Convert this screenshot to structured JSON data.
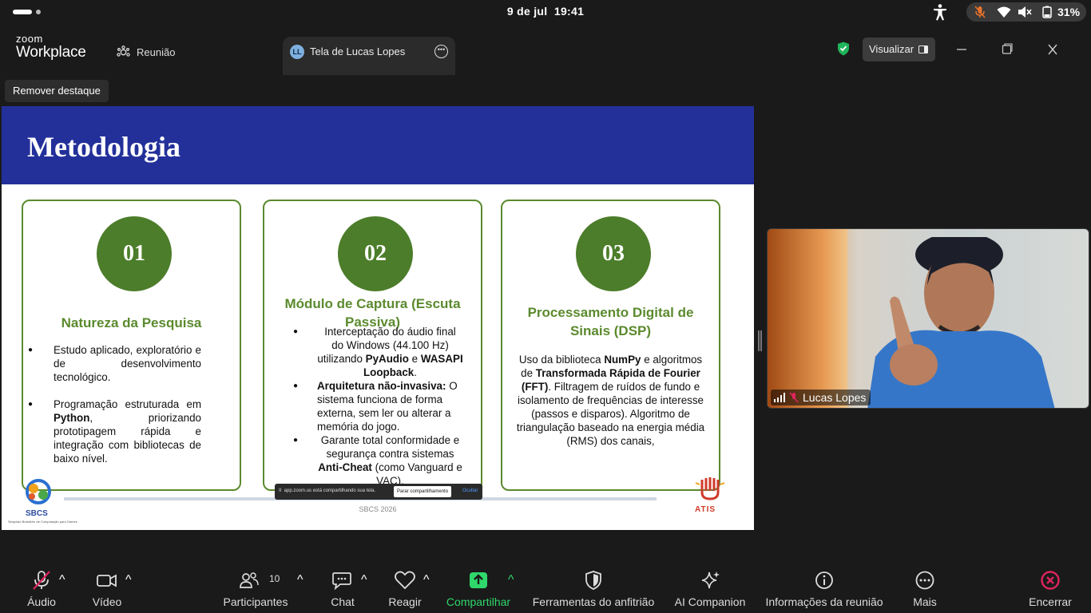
{
  "status_bar": {
    "date": "9 de jul",
    "time": "19:41",
    "battery": "31%"
  },
  "titlebar": {
    "logo_line1": "zoom",
    "logo_line2": "Workplace",
    "tab_meeting": "Reunião",
    "tab_share_avatar": "LL",
    "tab_share_label": "Tela de Lucas Lopes",
    "visualizar": "Visualizar"
  },
  "stage": {
    "remover_destaque": "Remover destaque"
  },
  "slide": {
    "title": "Metodologia",
    "cards": [
      {
        "number": "01",
        "title": "Natureza da Pesquisa",
        "b1": "Estudo aplicado, exploratório e de desenvolvimento tecnológico.",
        "b2_pre": "Programação estruturada em ",
        "b2_bold": "Python",
        "b2_post": ", priorizando prototipagem rápida e integração com bibliotecas de baixo nível."
      },
      {
        "number": "02",
        "title": "Módulo de Captura (Escuta Passiva)",
        "b1_pre": "Interceptação do áudio final do Windows (44.100 Hz) utilizando ",
        "b1_bold1": "PyAudio",
        "b1_mid": " e ",
        "b1_bold2": "WASAPI Loopback",
        "b1_post": ".",
        "b2_bold": "Arquitetura não-invasiva:",
        "b2_post": " O sistema funciona de forma externa, sem ler ou alterar a memória do jogo.",
        "b3_pre": "Garante total conformidade e segurança contra sistemas ",
        "b3_bold": "Anti-Cheat",
        "b3_post": " (como Vanguard e VAC)."
      },
      {
        "number": "03",
        "title": "Processamento Digital de Sinais (DSP)",
        "p_pre": "Uso da biblioteca ",
        "p_bold1": "NumPy",
        "p_mid": " e algoritmos de ",
        "p_bold2": "Transformada Rápida de Fourier (FFT)",
        "p_post": ". Filtragem de ruídos de fundo e isolamento de frequências de interesse (passos e disparos). Algoritmo de triangulação baseado na energia média (RMS) dos canais,"
      }
    ],
    "logo_left": "SBCS",
    "logo_left_small": "Simpósio Brasileiro de Computação para Games",
    "footer": "SBCS 2026",
    "logo_right": "ATIS"
  },
  "share_notice": {
    "text": "app.zoom.us está compartilhando sua tela.",
    "stop": "Parar compartilhamento",
    "hide": "Ocultar"
  },
  "video": {
    "name": "Lucas Lopes"
  },
  "toolbar": {
    "audio": "Áudio",
    "video": "Vídeo",
    "participants": "Participantes",
    "participants_count": "10",
    "chat": "Chat",
    "react": "Reagir",
    "share": "Compartilhar",
    "host_tools": "Ferramentas do anfitrião",
    "ai": "AI Companion",
    "info": "Informações da reunião",
    "more": "Mais",
    "end": "Encerrar"
  },
  "colors": {
    "slide_header": "#23309a",
    "card_green": "#4c7d2a",
    "share_green": "#2fd86b",
    "end_red": "#e0245e"
  }
}
